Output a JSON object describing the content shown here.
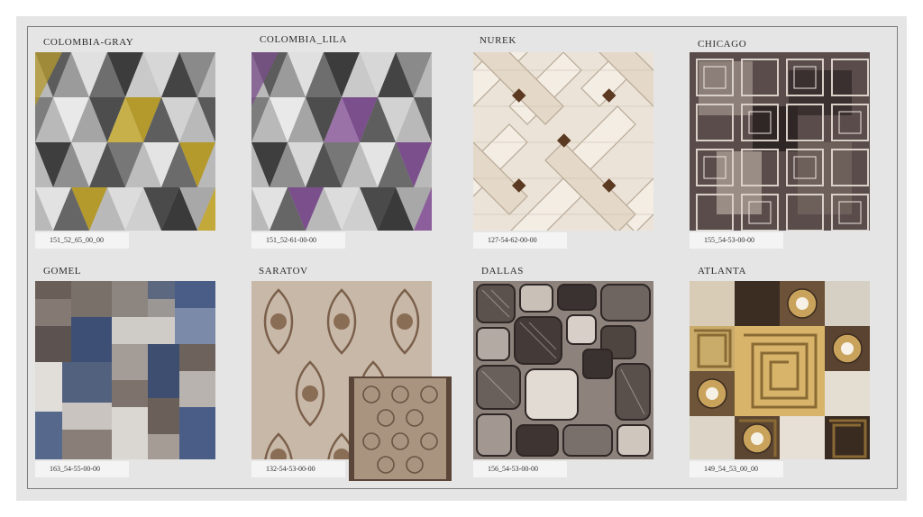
{
  "products": [
    {
      "name": "COLOMBIA-GRAY",
      "code": "151_52_65_00_00",
      "pattern": "harlequin-triangles",
      "accent": "#b49a2c"
    },
    {
      "name": "COLOMBIA_LILA",
      "code": "151_52-61-00-00",
      "pattern": "harlequin-triangles",
      "accent": "#7b4f8c"
    },
    {
      "name": "NUREK",
      "code": "127-54-62-00-00",
      "pattern": "woven-lattice",
      "accent": "#5c3a22"
    },
    {
      "name": "CHICAGO",
      "code": "155_54-53-00-00",
      "pattern": "grid-squares",
      "accent": "#3e3333"
    },
    {
      "name": "GOMEL",
      "code": "163_54-55-00-00",
      "pattern": "patchwork-blocks",
      "accent": "#4a5d86"
    },
    {
      "name": "SARATOV",
      "code": "132-54-53-00-00",
      "pattern": "damask-floral",
      "accent": "#7a5f4a"
    },
    {
      "name": "DALLAS",
      "code": "156_54-53-00-00",
      "pattern": "rounded-tiles",
      "accent": "#3a3230"
    },
    {
      "name": "ATLANTA",
      "code": "149_54_53_00_00",
      "pattern": "greek-key-medallions",
      "accent": "#b08a3c"
    }
  ]
}
